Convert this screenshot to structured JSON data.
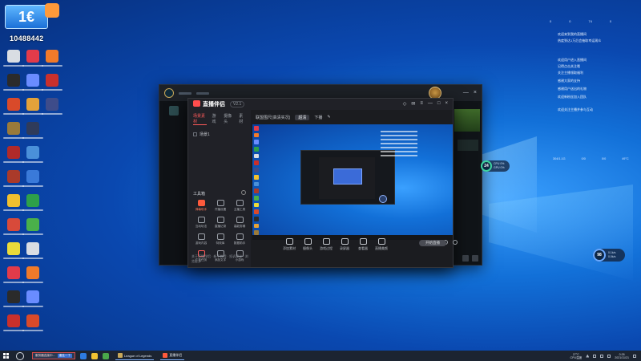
{
  "stream_overlay": {
    "logo_text": "1€",
    "number": "10488442"
  },
  "colors": {
    "desktop": "#1270d8",
    "window_bg": "#15181d",
    "accent_red": "#ff5a5a",
    "taskbar": "#1c2431"
  },
  "desktop_icons": [
    {
      "icon": "app-red-icon",
      "color": "#e23b4a"
    },
    {
      "icon": "app-orange-icon",
      "color": "#f07a2a"
    },
    {
      "icon": "app-dark-icon",
      "color": "#2b2b2b"
    }
  ],
  "lol_window": {
    "avatar_icon": "champion-avatar-icon"
  },
  "tool": {
    "brand": "直播伴侣",
    "badge": "V2.1",
    "tabs": [
      "场景素材",
      "游戏",
      "摄像头",
      "素材"
    ],
    "scene_label": "场景1",
    "tools_label": "工具箱",
    "tools": [
      {
        "label": "弹幕助手"
      },
      {
        "label": "开播设置"
      },
      {
        "label": "主播工具"
      },
      {
        "label": "互动玩法"
      },
      {
        "label": "直播记录"
      },
      {
        "label": "高能剪辑"
      },
      {
        "label": "游戏内容"
      },
      {
        "label": "特效库"
      },
      {
        "label": "数据助手"
      },
      {
        "label": "广告任务"
      },
      {
        "label": "添加文字"
      },
      {
        "label": "小游戏"
      }
    ],
    "footer": "关于直播伴侣 · 新手教程 · 投诉建议 · 浏览更多",
    "toolbar_title": "联盟围尺(高清实况)",
    "toolbar_pill": "超清",
    "toolbar_right": "下播",
    "toolbar2": [
      "直播画面",
      "录屏设置",
      "全屏模式"
    ],
    "actions": [
      {
        "label": "添加素材"
      },
      {
        "label": "摄像头"
      },
      {
        "label": "游戏过程"
      },
      {
        "label": "录屏器"
      },
      {
        "label": "查看器"
      },
      {
        "label": "直播美颜"
      }
    ],
    "start_live": "开始直播"
  },
  "right_overlay": {
    "top_stats": [
      "0",
      "0",
      "74",
      "0"
    ],
    "lines": [
      "欢迎来到我的直播间",
      "热度到达1万后会抽取幸运观众",
      "欢迎用户进入直播间",
      "记得点击关注哦",
      "关注主播领取福利",
      "感谢大家的支持",
      "感谢用户送出的礼物",
      "欢迎新粉丝加入团队",
      "欢迎关注主播并参与互动"
    ],
    "stats_row": [
      "304/1.1G",
      "0/0",
      "0/0",
      "49°C"
    ],
    "gauge_big": {
      "value": "24",
      "line1": "CPU 0%",
      "line2": "GPU 0%"
    },
    "gauge_small": {
      "value": "98",
      "line1": "0.1k/s",
      "line2": "0.0k/s"
    }
  },
  "taskbar": {
    "task_text": "服务器连接中...",
    "task_btn": "重连一下",
    "app1": "League of Legends",
    "app2": "直播伴侣",
    "temp": "27°C",
    "temp_sub": "CPU温度",
    "time": "0:26",
    "date": "2021/11/21"
  }
}
